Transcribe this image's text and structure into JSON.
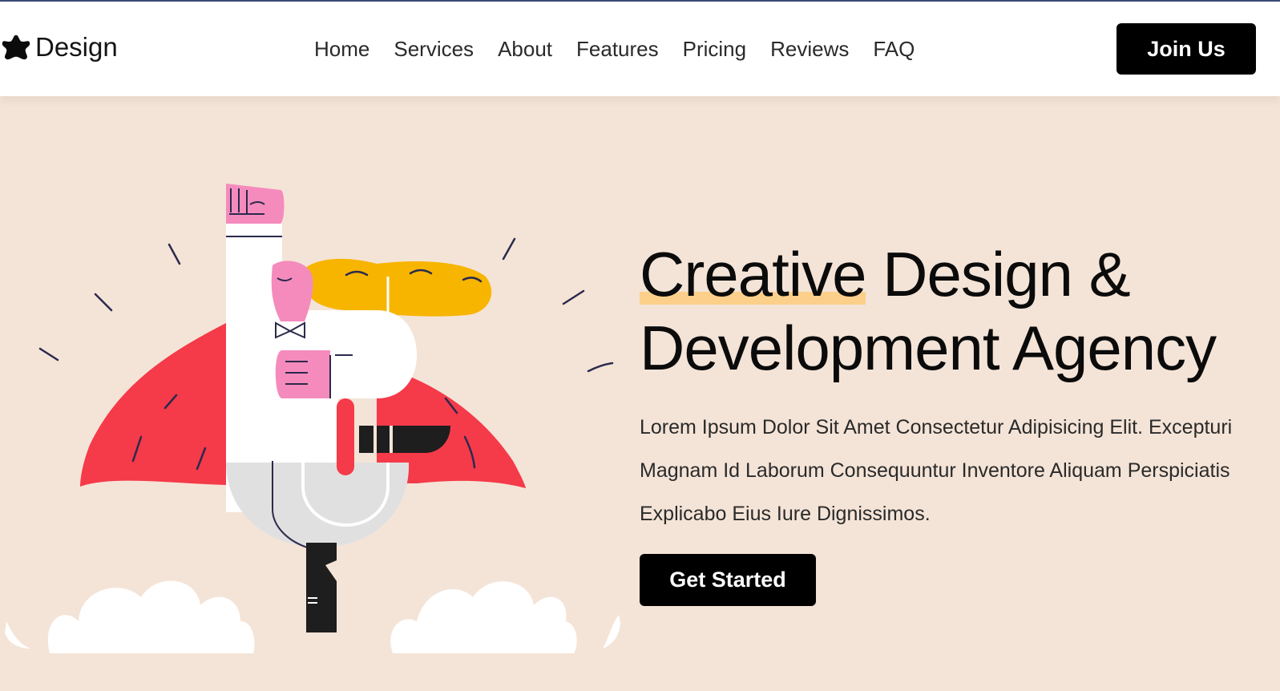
{
  "brand": {
    "name": "Design",
    "icon": "star-blob-icon"
  },
  "nav": {
    "items": [
      {
        "label": "Home"
      },
      {
        "label": "Services"
      },
      {
        "label": "About"
      },
      {
        "label": "Features"
      },
      {
        "label": "Pricing"
      },
      {
        "label": "Reviews"
      },
      {
        "label": "FAQ"
      }
    ],
    "cta_label": "Join Us"
  },
  "hero": {
    "title_highlight": "Creative",
    "title_rest_line1": " Design &",
    "title_line2": "Development Agency",
    "description": "Lorem Ipsum Dolor Sit Amet Consectetur Adipisicing Elit. Excepturi Magnam Id Laborum Consequuntur Inventore Aliquam Perspiciatis Explicabo Eius Iure Dignissimos.",
    "cta_label": "Get Started",
    "illustration": "superhero-letter-f-illustration"
  },
  "colors": {
    "page_bg": "#f4e4d7",
    "header_bg": "#ffffff",
    "accent_highlight": "#fcd08a",
    "button_bg": "#000000",
    "cape_red": "#f53a4a",
    "hair_yellow": "#f7b500",
    "skin_pink": "#f58bbd"
  }
}
